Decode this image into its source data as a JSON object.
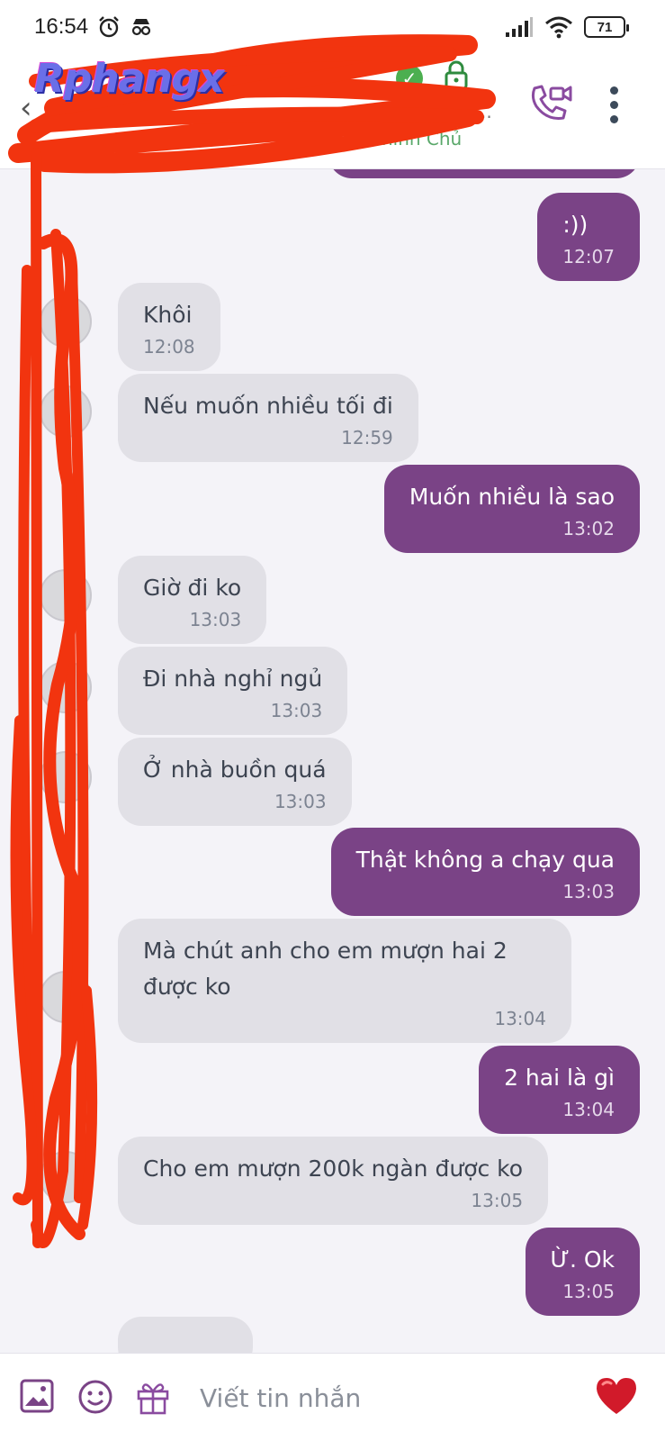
{
  "status_bar": {
    "time": "16:54",
    "battery": "71"
  },
  "header": {
    "contact_name": "",
    "contact_sub": "đ...",
    "contact_status": "Chính Chủ"
  },
  "watermark": "Rphangx",
  "messages": [
    {
      "dir": "out",
      "text": ":))",
      "time": "12:07"
    },
    {
      "dir": "in",
      "text": "Khôi",
      "time": "12:08"
    },
    {
      "dir": "in",
      "text": "Nếu muốn nhiều tối đi",
      "time": "12:59"
    },
    {
      "dir": "out",
      "text": "Muốn nhiều là sao",
      "time": "13:02"
    },
    {
      "dir": "in",
      "text": "Giờ đi ko",
      "time": "13:03"
    },
    {
      "dir": "in",
      "text": "Đi nhà nghỉ ngủ",
      "time": "13:03"
    },
    {
      "dir": "in",
      "text": "Ở nhà buồn quá",
      "time": "13:03"
    },
    {
      "dir": "out",
      "text": "Thật không a chạy qua",
      "time": "13:03"
    },
    {
      "dir": "in",
      "text": "Mà chút anh cho em mượn hai 2 được ko",
      "time": "13:04"
    },
    {
      "dir": "out",
      "text": "2 hai là gì",
      "time": "13:04"
    },
    {
      "dir": "in",
      "text": "Cho em mượn 200k ngàn được ko",
      "time": "13:05"
    },
    {
      "dir": "out",
      "text": "Ừ. Ok",
      "time": "13:05"
    }
  ],
  "composer": {
    "placeholder": "Viết tin nhắn"
  },
  "colors": {
    "accent": "#7a4386",
    "incoming_bubble": "#e1e0e6",
    "chat_background": "#f4f3f8",
    "scribble": "#f2340f"
  },
  "icons": [
    "alarm-icon",
    "incognito-icon",
    "signal-icon",
    "wifi-icon",
    "battery-icon",
    "back-arrow-icon",
    "verified-icon",
    "lock-icon",
    "video-call-icon",
    "more-vert-icon",
    "image-icon",
    "emoji-icon",
    "gift-icon",
    "heart-icon"
  ]
}
